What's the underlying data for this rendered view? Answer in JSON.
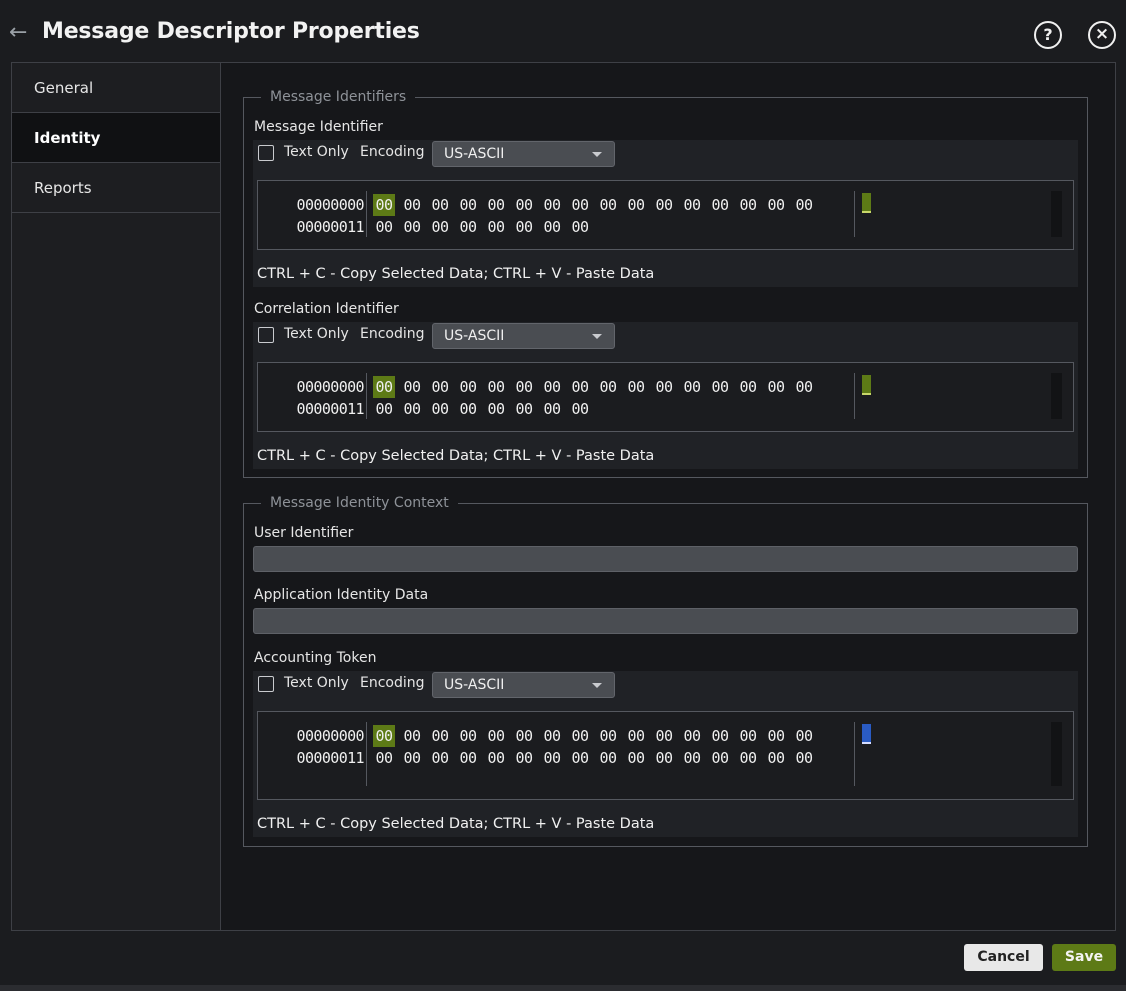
{
  "header": {
    "title": "Message Descriptor Properties",
    "back_icon": "arrow-left-icon",
    "help_icon": "?",
    "close_icon": "×"
  },
  "tabs": [
    {
      "label": "General",
      "active": false
    },
    {
      "label": "Identity",
      "active": true
    },
    {
      "label": "Reports",
      "active": false
    }
  ],
  "identifiers_group": {
    "legend": "Message Identifiers",
    "message_identifier": {
      "label": "Message Identifier",
      "text_only_label": "Text Only",
      "encoding_label": "Encoding",
      "encoding_value": "US-ASCII",
      "offsets": [
        "00000000",
        "00000011"
      ],
      "row1": [
        "00",
        "00",
        "00",
        "00",
        "00",
        "00",
        "00",
        "00",
        "00",
        "00",
        "00",
        "00",
        "00",
        "00",
        "00",
        "00"
      ],
      "row2": [
        "00",
        "00",
        "00",
        "00",
        "00",
        "00",
        "00",
        "00"
      ],
      "hint": "CTRL + C - Copy Selected Data; CTRL + V - Paste Data"
    },
    "correlation_identifier": {
      "label": "Correlation Identifier",
      "text_only_label": "Text Only",
      "encoding_label": "Encoding",
      "encoding_value": "US-ASCII",
      "offsets": [
        "00000000",
        "00000011"
      ],
      "row1": [
        "00",
        "00",
        "00",
        "00",
        "00",
        "00",
        "00",
        "00",
        "00",
        "00",
        "00",
        "00",
        "00",
        "00",
        "00",
        "00"
      ],
      "row2": [
        "00",
        "00",
        "00",
        "00",
        "00",
        "00",
        "00",
        "00"
      ],
      "hint": "CTRL + C - Copy Selected Data; CTRL + V - Paste Data"
    }
  },
  "context_group": {
    "legend": "Message Identity Context",
    "user_identifier": {
      "label": "User Identifier",
      "value": ""
    },
    "application_identity_data": {
      "label": "Application Identity Data",
      "value": ""
    },
    "accounting_token": {
      "label": "Accounting Token",
      "text_only_label": "Text Only",
      "encoding_label": "Encoding",
      "encoding_value": "US-ASCII",
      "offsets": [
        "00000000",
        "00000011"
      ],
      "row1": [
        "00",
        "00",
        "00",
        "00",
        "00",
        "00",
        "00",
        "00",
        "00",
        "00",
        "00",
        "00",
        "00",
        "00",
        "00",
        "00"
      ],
      "row2": [
        "00",
        "00",
        "00",
        "00",
        "00",
        "00",
        "00",
        "00",
        "00",
        "00",
        "00",
        "00",
        "00",
        "00",
        "00",
        "00"
      ],
      "hint": "CTRL + C - Copy Selected Data; CTRL + V - Paste Data"
    }
  },
  "footer": {
    "cancel_label": "Cancel",
    "save_label": "Save"
  },
  "colors": {
    "accent_green": "#5d7a16",
    "selection_blue": "#2a5bc2",
    "background": "#16171a"
  }
}
